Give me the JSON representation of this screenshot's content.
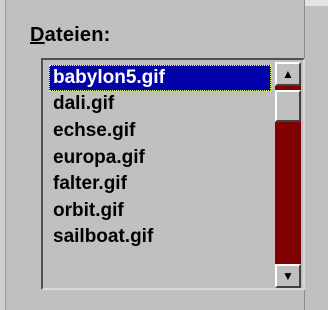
{
  "label": {
    "hotkey": "D",
    "rest": "ateien:"
  },
  "files": [
    "babylon5.gif",
    "dali.gif",
    "echse.gif",
    "europa.gif",
    "falter.gif",
    "orbit.gif",
    "sailboat.gif"
  ],
  "selected_index": 0,
  "icons": {
    "up": "▲",
    "down": "▼"
  },
  "colors": {
    "selection": "#0000a8",
    "scroll_track": "#800000",
    "background": "#c0c0c0"
  }
}
